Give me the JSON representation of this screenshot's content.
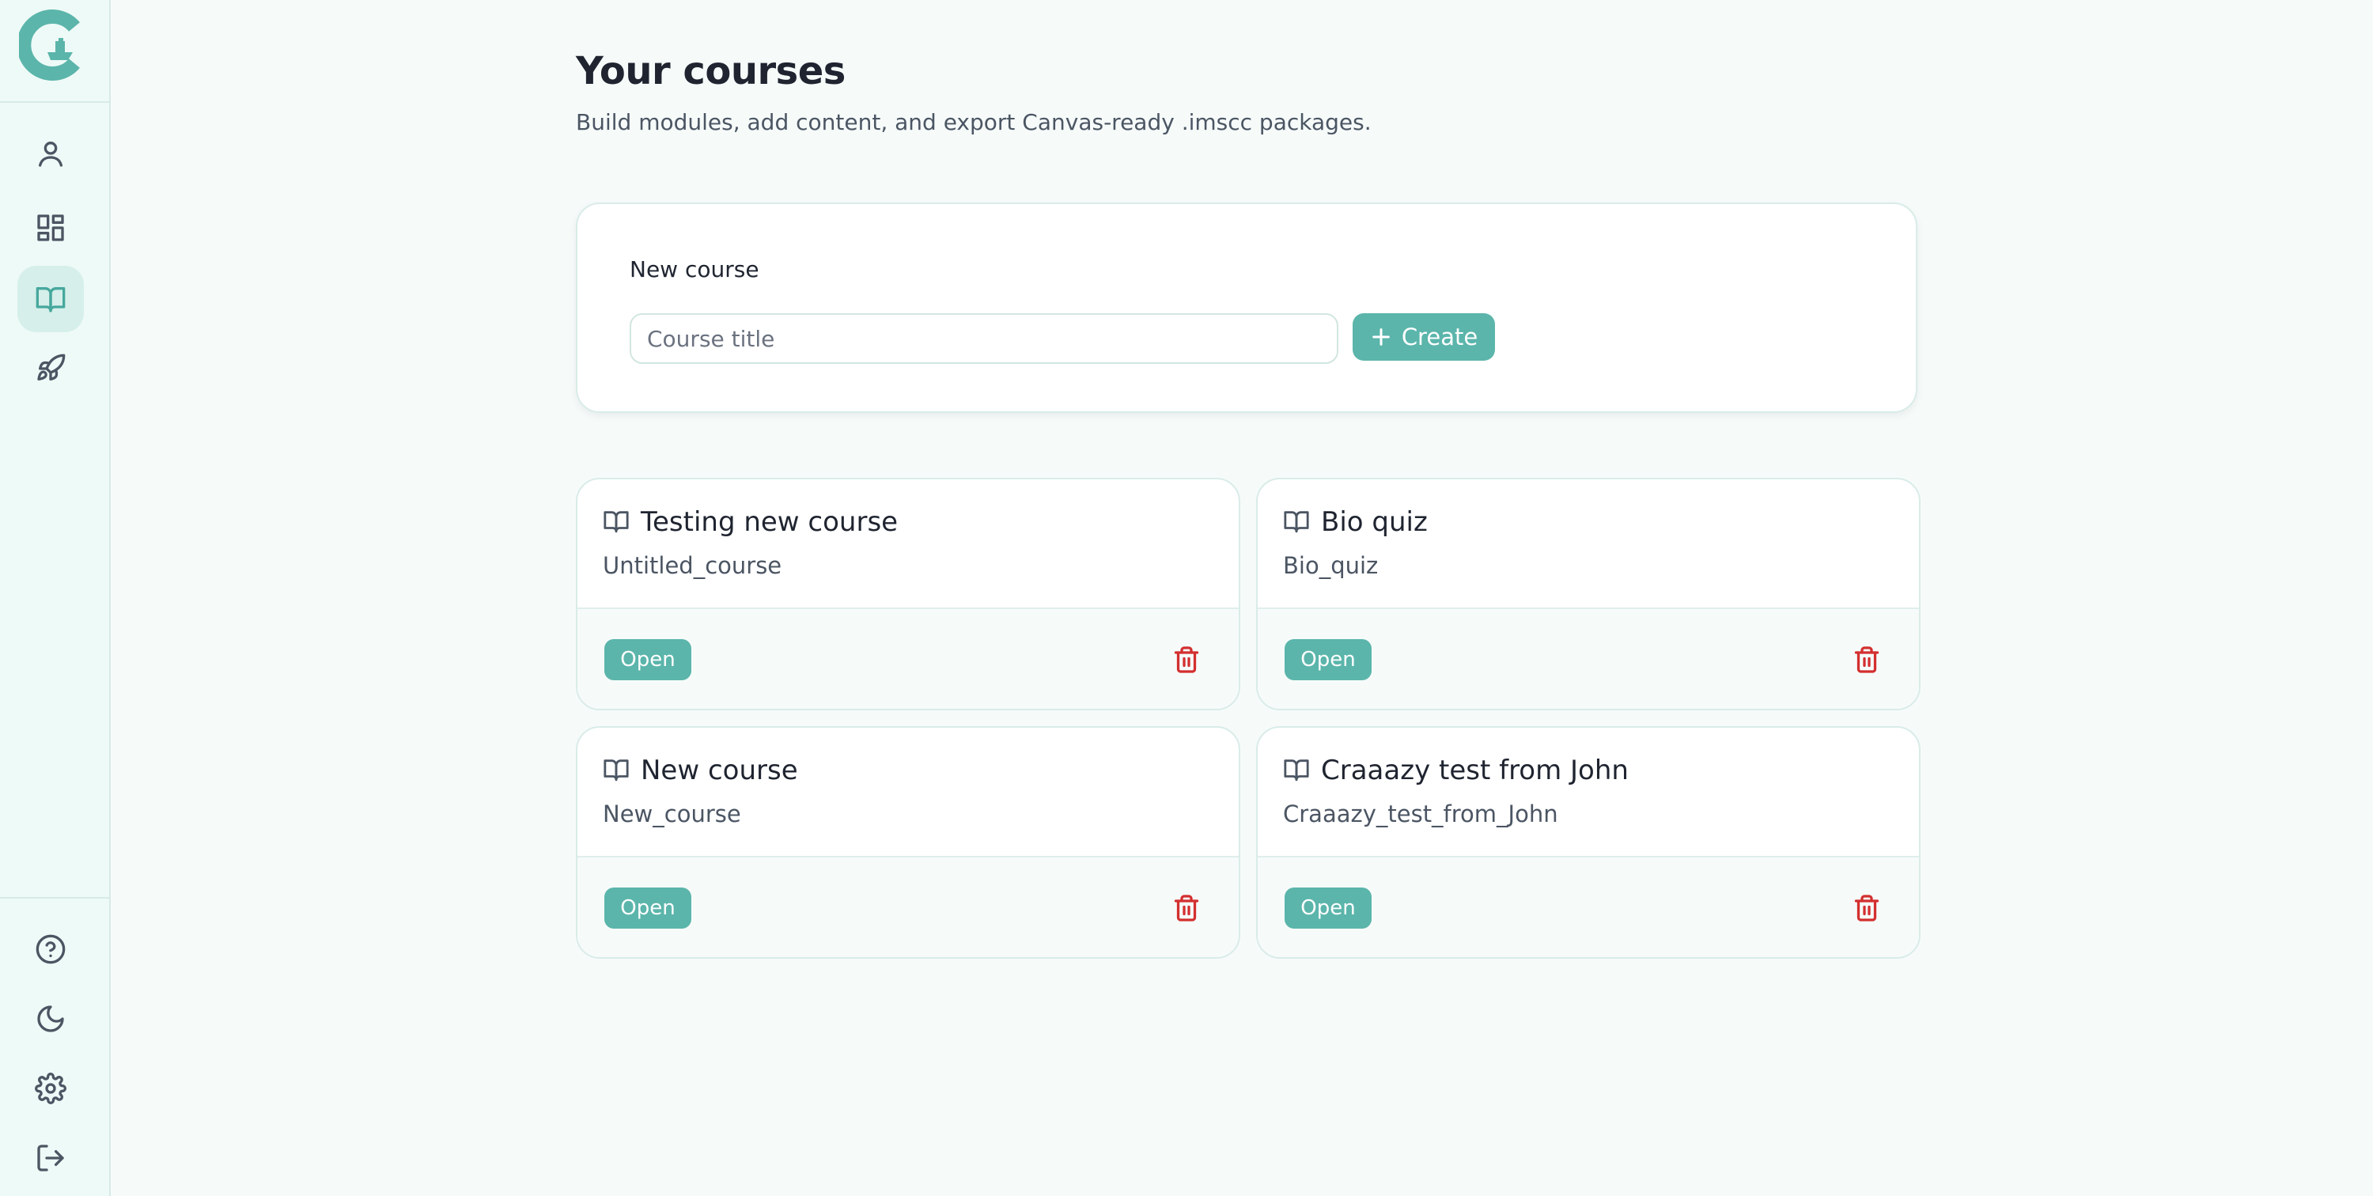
{
  "sidebar": {
    "logo_icon": "brand-logo",
    "top_items": [
      {
        "name": "profile",
        "icon": "user-icon",
        "active": false
      },
      {
        "name": "dashboard",
        "icon": "dashboard-grid-icon",
        "active": false
      },
      {
        "name": "courses",
        "icon": "book-open-icon",
        "active": true
      },
      {
        "name": "launch",
        "icon": "rocket-icon",
        "active": false
      }
    ],
    "bottom_items": [
      {
        "name": "help",
        "icon": "help-circle-icon"
      },
      {
        "name": "theme",
        "icon": "moon-icon"
      },
      {
        "name": "settings",
        "icon": "gear-icon"
      },
      {
        "name": "logout",
        "icon": "logout-icon"
      }
    ]
  },
  "header": {
    "title": "Your courses",
    "subtitle": "Build modules, add content, and export Canvas-ready .imscc packages."
  },
  "new_course": {
    "label": "New course",
    "input_placeholder": "Course title",
    "input_value": "",
    "create_label": "Create"
  },
  "courses": [
    {
      "title": "Testing new course",
      "slug": "Untitled_course",
      "open_label": "Open"
    },
    {
      "title": "Bio quiz",
      "slug": "Bio_quiz",
      "open_label": "Open"
    },
    {
      "title": "New course",
      "slug": "New_course",
      "open_label": "Open"
    },
    {
      "title": "Craaazy test from John",
      "slug": "Craaazy_test_from_John",
      "open_label": "Open"
    }
  ],
  "colors": {
    "accent": "#5bb5ab",
    "danger": "#d32f2f",
    "background": "#f6fbfa",
    "sidebar": "#eefaf7"
  }
}
